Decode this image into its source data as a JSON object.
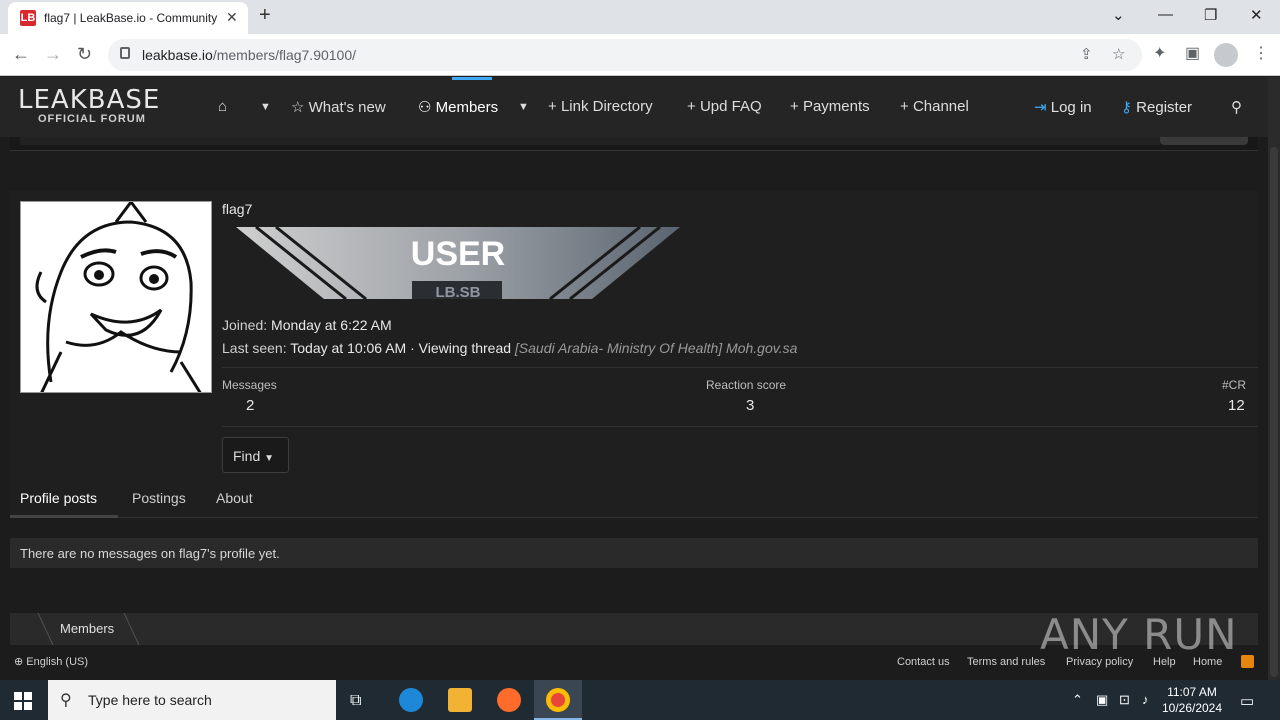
{
  "browser": {
    "tab_title": "flag7 | LeakBase.io - Community",
    "tab_favicon": "LB",
    "url_host": "leakbase.io",
    "url_path": "/members/flag7.90100/"
  },
  "site": {
    "logo_line1": "LEAKBASE",
    "logo_line2": "OFFICIAL FORUM",
    "nav": {
      "whats_new": "What's new",
      "members": "Members",
      "link_directory": "Link Directory",
      "upd_faq": "Upd FAQ",
      "payments": "Payments",
      "channel": "Channel",
      "login": "Log in",
      "register": "Register"
    }
  },
  "profile": {
    "username": "flag7",
    "banner_text": "USER",
    "banner_sub": "LB.SB",
    "joined_label": "Joined:",
    "joined_value": "Monday at 6:22 AM",
    "last_seen_label": "Last seen:",
    "last_seen_value": "Today at 10:06 AM · Viewing thread",
    "last_seen_thread": "[Saudi Arabia- Ministry Of Health] Moh.gov.sa",
    "stats": {
      "messages_label": "Messages",
      "messages_value": "2",
      "reaction_label": "Reaction score",
      "reaction_value": "3",
      "cr_label": "#CR",
      "cr_value": "12"
    },
    "find_label": "Find",
    "tabs": [
      "Profile posts",
      "Postings",
      "About"
    ],
    "empty_message": "There are no messages on flag7's profile yet."
  },
  "breadcrumb": {
    "members": "Members"
  },
  "footer": {
    "language": "English (US)",
    "links": [
      "Contact us",
      "Terms and rules",
      "Privacy policy",
      "Help",
      "Home"
    ]
  },
  "watermark": "ANY RUN",
  "taskbar": {
    "search_placeholder": "Type here to search",
    "time": "11:07 AM",
    "date": "10/26/2024"
  },
  "colors": {
    "accent": "#3fa9f5",
    "background": "#1c1c1c",
    "header": "#252525"
  }
}
